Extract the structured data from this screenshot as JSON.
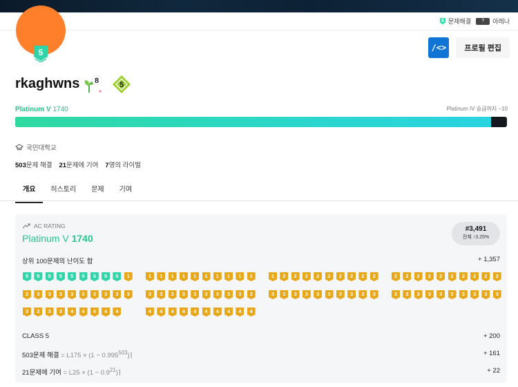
{
  "topbar": {
    "solved_label": "문제해결",
    "solved_badge": "5",
    "arena_badge": "?",
    "arena_label": "아레나"
  },
  "profile": {
    "tier_badge": "5",
    "username": "rkaghwns",
    "sprout_level": "8",
    "class_level": "5",
    "tier_name": "Platinum V",
    "rating": "1740",
    "next_tier": "Platinum IV 승급까지 −10",
    "progress": 0.967,
    "school": "국민대학교",
    "stats": [
      {
        "num": "503",
        "label": "문제 해결"
      },
      {
        "num": "21",
        "label": "문제에 기여"
      },
      {
        "num": "7",
        "label": "명의 라이벌"
      }
    ],
    "edit_label": "프로필 편집",
    "code_icon": "/<>"
  },
  "tabs": [
    "개요",
    "히스토리",
    "문제",
    "기여"
  ],
  "rating_panel": {
    "label": "AC RATING",
    "tier_name": "Platinum V",
    "rating": "1740",
    "rank": "#3,491",
    "rank_sub": "전체 ↑3.25%",
    "top100_label": "상위 100문제의 난이도 합",
    "top100_value": "+ 1,357",
    "badge_groups": [
      {
        "color": "p",
        "nums": [
          "5",
          "5",
          "5",
          "5",
          "5",
          "5",
          "5",
          "5",
          "5"
        ]
      },
      {
        "color": "g",
        "nums": [
          "1"
        ]
      },
      {
        "color": "g",
        "nums": [
          "1",
          "1",
          "1",
          "1",
          "1",
          "1",
          "1",
          "1",
          "1",
          "1"
        ]
      },
      {
        "color": "g",
        "nums": [
          "1",
          "2",
          "2",
          "2",
          "2",
          "2",
          "2",
          "2",
          "2",
          "2"
        ]
      },
      {
        "color": "g",
        "nums": [
          "2",
          "2",
          "2",
          "2",
          "2",
          "2",
          "2",
          "2",
          "2",
          "2"
        ]
      },
      {
        "color": "g",
        "nums": [
          "2",
          "3",
          "3",
          "3",
          "3",
          "3",
          "3",
          "3",
          "3",
          "3"
        ]
      },
      {
        "color": "g",
        "nums": [
          "3",
          "3",
          "3",
          "3",
          "3",
          "3",
          "3",
          "3",
          "3",
          "3"
        ]
      },
      {
        "color": "g",
        "nums": [
          "3",
          "3",
          "3",
          "3",
          "3",
          "3",
          "3",
          "3",
          "3",
          "3"
        ]
      },
      {
        "color": "g",
        "nums": [
          "3",
          "3",
          "3",
          "3",
          "3",
          "3",
          "3",
          "3",
          "3",
          "3"
        ]
      },
      {
        "color": "g",
        "nums": [
          "3",
          "3",
          "3",
          "3",
          "4",
          "4",
          "4",
          "4",
          "4"
        ]
      },
      {
        "color": "g",
        "nums": [
          "4",
          "4",
          "4",
          "4",
          "4",
          "4",
          "4",
          "4",
          "4",
          "4"
        ]
      }
    ],
    "class_label": "CLASS 5",
    "class_value": "+ 200",
    "solved_label": "503문제 해결",
    "solved_formula": "= L175 × (1 − 0.995",
    "solved_exp": "503",
    "solved_end": ")⌉",
    "solved_value": "+ 161",
    "contrib_label": "21문제에 기여",
    "contrib_formula": "= L25 × (1 − 0.9",
    "contrib_exp": "21",
    "contrib_end": ")⌉",
    "contrib_value": "+ 22"
  }
}
